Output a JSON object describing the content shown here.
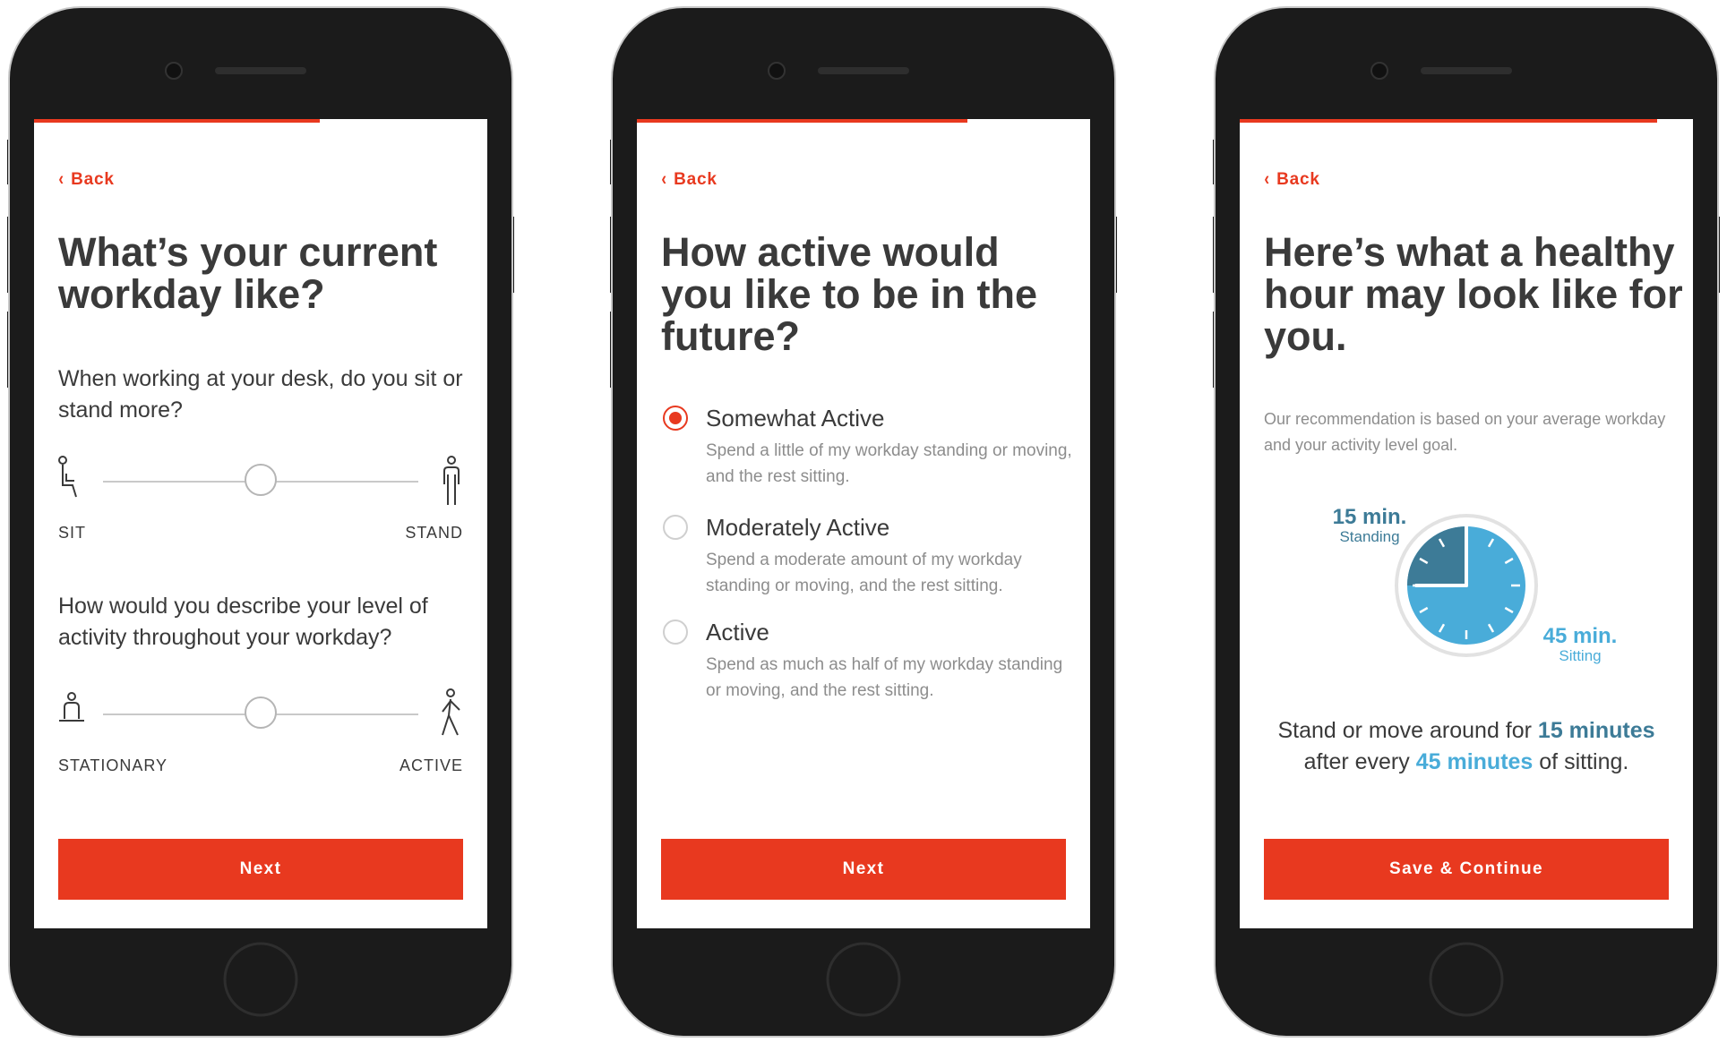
{
  "colors": {
    "accent": "#e8391f",
    "text": "#3a3a3a",
    "muted": "#8d8d8d",
    "standing": "#3d7b97",
    "sitting": "#49acd9",
    "frame": "#1b1b1b"
  },
  "screen1": {
    "progress": 0.63,
    "back_label": "Back",
    "title": "What’s your current workday like?",
    "q1": "When working at your desk, do you sit or stand more?",
    "slider1": {
      "left_label": "SIT",
      "right_label": "STAND",
      "left_icon": "sitting-person-icon",
      "right_icon": "standing-person-icon",
      "value": 0.5
    },
    "q2": "How would you describe your level of activity throughout your workday?",
    "slider2": {
      "left_label": "STATIONARY",
      "right_label": "ACTIVE",
      "left_icon": "stationary-person-icon",
      "right_icon": "walking-person-icon",
      "value": 0.5
    },
    "button": "Next"
  },
  "screen2": {
    "progress": 0.73,
    "back_label": "Back",
    "title": "How active would you like to be in the future?",
    "options": [
      {
        "label": "Somewhat Active",
        "desc": "Spend a little of my workday standing or moving, and the rest sitting.",
        "selected": true
      },
      {
        "label": "Moderately Active",
        "desc": "Spend a moderate amount of my workday standing or moving, and the rest sitting.",
        "selected": false
      },
      {
        "label": "Active",
        "desc": "Spend as much as half of my workday standing or moving, and the rest sitting.",
        "selected": false
      }
    ],
    "button": "Next"
  },
  "screen3": {
    "progress": 0.92,
    "back_label": "Back",
    "title": "Here’s what a healthy hour may look like for you.",
    "recommendation": "Our recommendation is based on your average workday and your activity level goal.",
    "clock": {
      "standing_minutes": 15,
      "sitting_minutes": 45,
      "standing_value": "15 min.",
      "standing_label": "Standing",
      "sitting_value": "45 min.",
      "sitting_label": "Sitting"
    },
    "summary": {
      "pre": "Stand or move around for ",
      "stand": "15 minutes",
      "mid": "after every ",
      "sit": "45 minutes",
      "post": " of sitting."
    },
    "button": "Save & Continue"
  }
}
